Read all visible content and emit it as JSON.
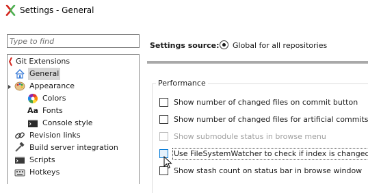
{
  "window": {
    "title": "Settings - General",
    "icon": "git-extensions-icon"
  },
  "search": {
    "placeholder": "Type to find",
    "value": ""
  },
  "tree": {
    "items": [
      {
        "label": "Git Extensions",
        "icon": "git-extensions-icon"
      },
      {
        "label": "General",
        "icon": "home-icon",
        "selected": true
      },
      {
        "label": "Appearance",
        "icon": "palette-icon"
      },
      {
        "label": "Colors",
        "icon": "color-wheel-icon"
      },
      {
        "label": "Fonts",
        "icon": "fonts-icon"
      },
      {
        "label": "Console style",
        "icon": "console-icon"
      },
      {
        "label": "Revision links",
        "icon": "link-icon"
      },
      {
        "label": "Build server integration",
        "icon": "build-server-icon"
      },
      {
        "label": "Scripts",
        "icon": "scripts-icon"
      },
      {
        "label": "Hotkeys",
        "icon": "hotkeys-icon"
      }
    ],
    "fonts_glyph": "Aa"
  },
  "settings_source": {
    "label": "Settings source:",
    "option": "Global for all repositories",
    "selected": true
  },
  "performance": {
    "title": "Performance",
    "options": [
      {
        "label": "Show number of changed files on commit button",
        "checked": false,
        "enabled": true
      },
      {
        "label": "Show number of changed files for artificial commits",
        "checked": false,
        "enabled": true
      },
      {
        "label": "Show submodule status in browse menu",
        "checked": false,
        "enabled": false
      },
      {
        "label": "Use FileSystemWatcher to check if index is changed",
        "checked": false,
        "enabled": true,
        "focused": true
      },
      {
        "label": "Show stash count on status bar in browse window",
        "checked": false,
        "enabled": true
      }
    ]
  },
  "colors": {
    "accent": "#0078d7",
    "selection": "#d6d6d6",
    "disabled_text": "#a0a0a0",
    "divider": "#a9a9a9"
  }
}
